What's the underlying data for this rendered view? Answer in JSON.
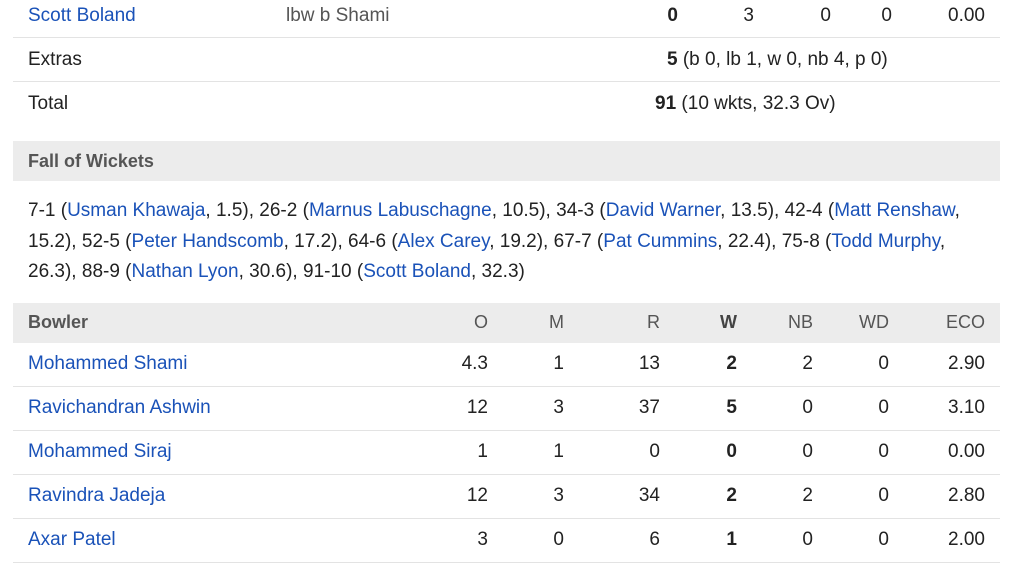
{
  "batting_last": {
    "name": "Scott Boland",
    "dismissal": "lbw b Shami",
    "runs": "0",
    "balls": "3",
    "fours": "0",
    "sixes": "0",
    "sr": "0.00"
  },
  "extras": {
    "label": "Extras",
    "value": "5",
    "detail": "(b 0, lb 1, w 0, nb 4, p 0)"
  },
  "total": {
    "label": "Total",
    "value": "91",
    "detail": "(10 wkts, 32.3 Ov)"
  },
  "fall_of_wickets": {
    "title": "Fall of Wickets",
    "items": [
      {
        "score": "7-1",
        "player": "Usman Khawaja",
        "over": "1.5"
      },
      {
        "score": "26-2",
        "player": "Marnus Labuschagne",
        "over": "10.5"
      },
      {
        "score": "34-3",
        "player": "David Warner",
        "over": "13.5"
      },
      {
        "score": "42-4",
        "player": "Matt Renshaw",
        "over": "15.2"
      },
      {
        "score": "52-5",
        "player": "Peter Handscomb",
        "over": "17.2"
      },
      {
        "score": "64-6",
        "player": "Alex Carey",
        "over": "19.2"
      },
      {
        "score": "67-7",
        "player": "Pat Cummins",
        "over": "22.4"
      },
      {
        "score": "75-8",
        "player": "Todd Murphy",
        "over": "26.3"
      },
      {
        "score": "88-9",
        "player": "Nathan Lyon",
        "over": "30.6"
      },
      {
        "score": "91-10",
        "player": "Scott Boland",
        "over": "32.3"
      }
    ]
  },
  "bowling": {
    "headers": {
      "name": "Bowler",
      "o": "O",
      "m": "M",
      "r": "R",
      "w": "W",
      "nb": "NB",
      "wd": "WD",
      "eco": "ECO"
    },
    "rows": [
      {
        "name": "Mohammed Shami",
        "o": "4.3",
        "m": "1",
        "r": "13",
        "w": "2",
        "nb": "2",
        "wd": "0",
        "eco": "2.90"
      },
      {
        "name": "Ravichandran Ashwin",
        "o": "12",
        "m": "3",
        "r": "37",
        "w": "5",
        "nb": "0",
        "wd": "0",
        "eco": "3.10"
      },
      {
        "name": "Mohammed Siraj",
        "o": "1",
        "m": "1",
        "r": "0",
        "w": "0",
        "nb": "0",
        "wd": "0",
        "eco": "0.00"
      },
      {
        "name": "Ravindra Jadeja",
        "o": "12",
        "m": "3",
        "r": "34",
        "w": "2",
        "nb": "2",
        "wd": "0",
        "eco": "2.80"
      },
      {
        "name": "Axar Patel",
        "o": "3",
        "m": "0",
        "r": "6",
        "w": "1",
        "nb": "0",
        "wd": "0",
        "eco": "2.00"
      }
    ]
  }
}
